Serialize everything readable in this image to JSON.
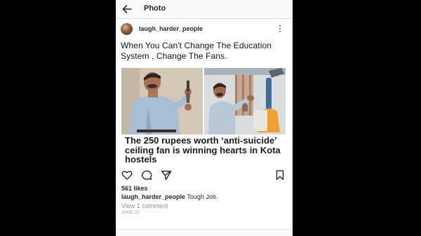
{
  "header": {
    "title": "Photo",
    "back_icon": "arrow-left-icon"
  },
  "post": {
    "username": "laugh_harder_people",
    "more_icon": "vertical-ellipsis-icon",
    "caption_title": "When You Can't Change The Education System , Change The Fans.",
    "image_headline": "The 250 rupees worth ‘anti-suicide’ ceiling fan is winning hearts in Kota hostels",
    "likes": "561 likes",
    "comment": {
      "user": "laugh_harder_people",
      "text": "Tough Job."
    },
    "view_comments": "View 1 comment",
    "date": "JUNE 22"
  },
  "actions": {
    "like_icon": "heart-icon",
    "comment_icon": "comment-icon",
    "share_icon": "send-icon",
    "save_icon": "bookmark-icon"
  },
  "colors": {
    "background": "#000000",
    "app_background": "#ffffff",
    "text": "#262626",
    "muted": "#8e8e8e"
  }
}
